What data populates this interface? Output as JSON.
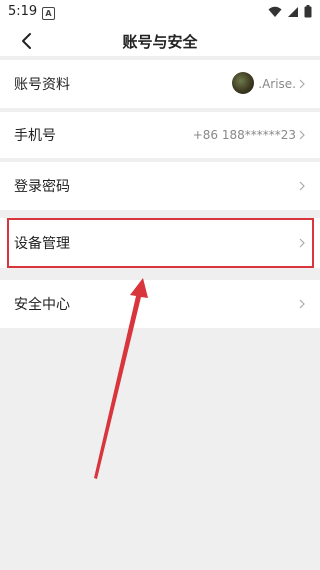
{
  "status_bar": {
    "time": "5:19",
    "notification_icon": "A"
  },
  "header": {
    "title": "账号与安全"
  },
  "rows": [
    {
      "label": "账号资料",
      "value": ".Arise."
    },
    {
      "label": "手机号",
      "value": "+86 188******23"
    },
    {
      "label": "登录密码",
      "value": ""
    },
    {
      "label": "设备管理",
      "value": ""
    },
    {
      "label": "安全中心",
      "value": ""
    }
  ],
  "colors": {
    "highlight": "#d8353d",
    "arrow": "#d8353d",
    "background": "#efefef"
  },
  "icons": [
    "back-icon",
    "chevron-right-icon",
    "wifi-icon",
    "signal-icon",
    "battery-icon"
  ]
}
